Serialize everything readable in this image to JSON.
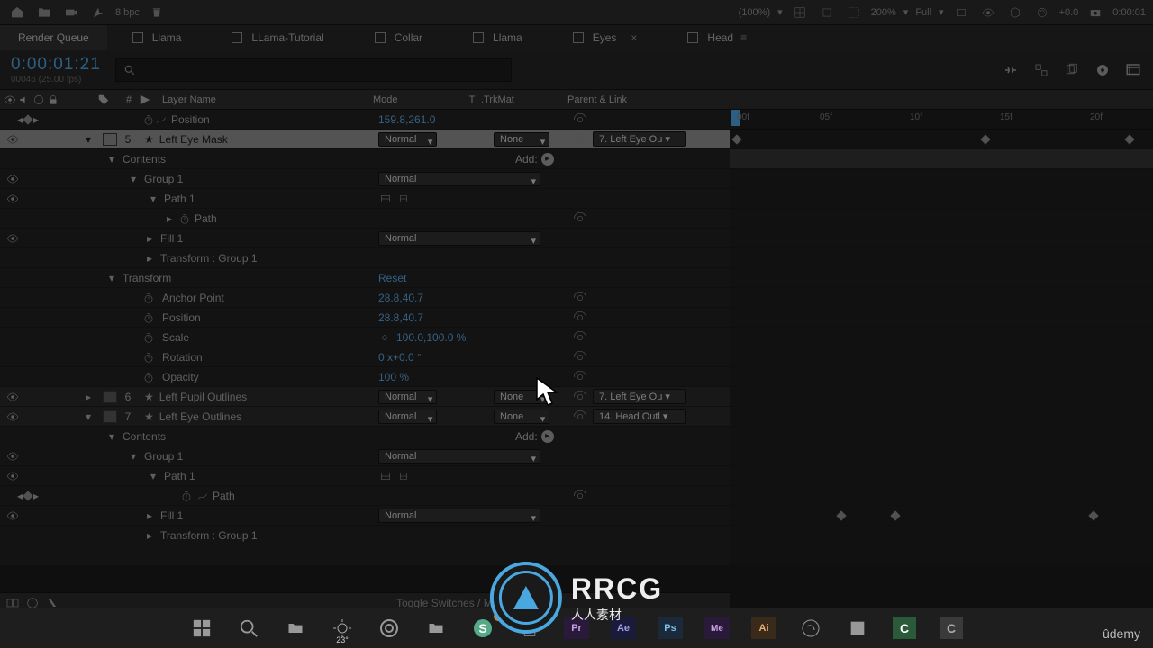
{
  "top": {
    "bpc": "8 bpc",
    "zoom1": "(100%)",
    "zoom2": "200%",
    "res": "Full",
    "offset": "+0.0",
    "time": "0:00:01"
  },
  "tabs": {
    "render_queue": "Render Queue",
    "items": [
      {
        "label": "Llama"
      },
      {
        "label": "LLama-Tutorial"
      },
      {
        "label": "Collar"
      },
      {
        "label": "Llama"
      },
      {
        "label": "Eyes"
      },
      {
        "label": "Head"
      }
    ]
  },
  "timecode": {
    "main": "0:00:01:21",
    "sub": "00046 (25.00 fps)"
  },
  "columns": {
    "num": "#",
    "name": "Layer Name",
    "mode": "Mode",
    "t": "T",
    "trk": ".TrkMat",
    "parent": "Parent & Link"
  },
  "ruler": [
    "00f",
    "05f",
    "10f",
    "15f",
    "20f"
  ],
  "rows": {
    "position_top": {
      "label": "Position",
      "value": "159.8,261.0"
    },
    "layer5": {
      "num": "5",
      "name": "Left Eye Mask",
      "mode": "Normal",
      "trk": "None",
      "parent": "7. Left Eye Ou"
    },
    "contents": "Contents",
    "add": "Add:",
    "group1": "Group 1",
    "group1_mode": "Normal",
    "path1": "Path 1",
    "path": "Path",
    "fill1": "Fill 1",
    "fill1_mode": "Normal",
    "transform_group1": "Transform : Group 1",
    "transform": "Transform",
    "reset": "Reset",
    "anchor": {
      "label": "Anchor Point",
      "value": "28.8,40.7"
    },
    "position": {
      "label": "Position",
      "value": "28.8,40.7"
    },
    "scale": {
      "label": "Scale",
      "value": "100.0,100.0 %"
    },
    "rotation": {
      "label": "Rotation",
      "value": "0 x+0.0 °"
    },
    "opacity": {
      "label": "Opacity",
      "value": "100 %"
    },
    "layer6": {
      "num": "6",
      "name": "Left Pupil Outlines",
      "mode": "Normal",
      "trk": "None",
      "parent": "7. Left Eye Ou"
    },
    "layer7": {
      "num": "7",
      "name": "Left Eye Outlines",
      "mode": "Normal",
      "trk": "None",
      "parent": "14. Head Outl"
    },
    "contents2": "Contents",
    "group1b": "Group 1",
    "group1b_mode": "Normal",
    "path1b": "Path 1",
    "pathb": "Path",
    "fill1b": "Fill 1",
    "fill1b_mode": "Normal",
    "transform_group1b": "Transform : Group 1"
  },
  "footer": {
    "toggle": "Toggle Switches / Modes"
  },
  "watermark": {
    "big": "RRCG",
    "sub": "人人素材"
  },
  "udemy": "ûdemy",
  "taskbar_temp": "23°"
}
